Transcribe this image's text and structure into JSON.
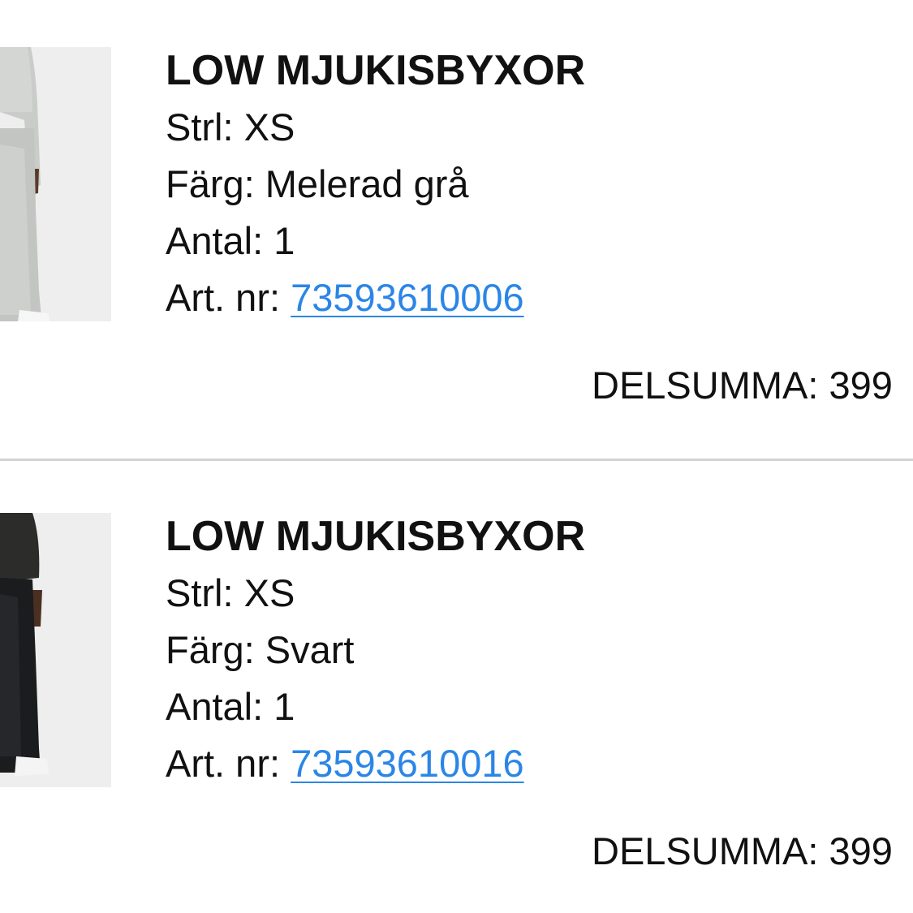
{
  "items": [
    {
      "title": "LOW MJUKISBYXOR",
      "size_label": "Strl:",
      "size": "XS",
      "color_label": "Färg:",
      "color": "Melerad grå",
      "qty_label": "Antal:",
      "qty": "1",
      "art_label": "Art. nr:",
      "art_nr": "73593610006",
      "subtotal_label": "DELSUMMA:",
      "subtotal": "399"
    },
    {
      "title": "LOW MJUKISBYXOR",
      "size_label": "Strl:",
      "size": "XS",
      "color_label": "Färg:",
      "color": "Svart",
      "qty_label": "Antal:",
      "qty": "1",
      "art_label": "Art. nr:",
      "art_nr": "73593610016",
      "subtotal_label": "DELSUMMA:",
      "subtotal": "399"
    }
  ],
  "colors": {
    "link": "#2a86e6",
    "divider": "#d2d2d2",
    "text": "#111111"
  }
}
